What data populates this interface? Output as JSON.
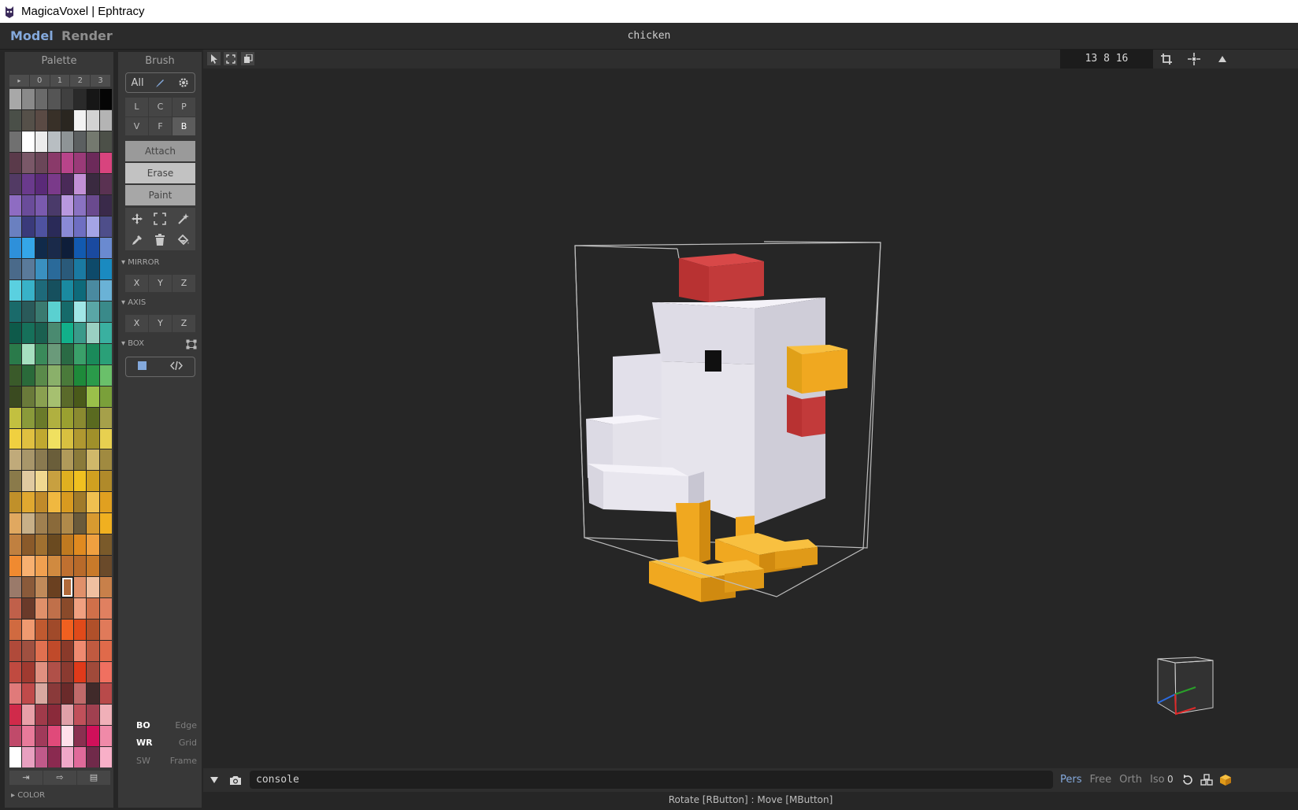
{
  "window": {
    "title": "MagicaVoxel | Ephtracy"
  },
  "topbar": {
    "tab_model": "Model",
    "tab_render": "Render",
    "filename": "chicken"
  },
  "palette": {
    "title": "Palette",
    "tabs": [
      "▸",
      "0",
      "1",
      "2",
      "3"
    ],
    "colors": [
      "#a8a8a8",
      "#8a8a8a",
      "#6a6a6a",
      "#555555",
      "#404040",
      "#2a2a2a",
      "#161616",
      "#050505",
      "#4a4f48",
      "#555049",
      "#5a4a44",
      "#383028",
      "#2a2620",
      "#f2f2f2",
      "#d2d2d2",
      "#b4b4b4",
      "#707070",
      "#ffffff",
      "#ececec",
      "#b8bec2",
      "#8e9496",
      "#5b5f60",
      "#74796f",
      "#4c5048",
      "#5a3a4a",
      "#7a5868",
      "#6a4658",
      "#8a3a6a",
      "#b8448a",
      "#9a3a78",
      "#6c2a5a",
      "#d8447e",
      "#523a64",
      "#6a3a8c",
      "#5a2a78",
      "#7a3a8a",
      "#4a2a58",
      "#c290d6",
      "#3a2a40",
      "#5a3252",
      "#8e6cc2",
      "#6a4c9a",
      "#7a5aae",
      "#4a3a6a",
      "#b898de",
      "#8a72c2",
      "#6a4a8e",
      "#3a2a4a",
      "#6a80c0",
      "#3a3a7a",
      "#4e52a0",
      "#2a2a58",
      "#8a8ad6",
      "#6e6ec2",
      "#a4a4e6",
      "#4e4e8a",
      "#2e90da",
      "#34a6e8",
      "#102a4a",
      "#1a2a4a",
      "#0e1e3a",
      "#125ab0",
      "#1a4aa0",
      "#6a8ad0",
      "#4a6a8a",
      "#5a7a9a",
      "#3a90c0",
      "#2a6a9a",
      "#2a5a7a",
      "#1a7aa2",
      "#0e4a6a",
      "#1a8ac0",
      "#5ad0e0",
      "#38b2c8",
      "#1e6a7a",
      "#16505e",
      "#1a8aa0",
      "#0e6a7a",
      "#4a8aa0",
      "#6ab2d6",
      "#1a6a6a",
      "#2a5a5a",
      "#3a7a70",
      "#5ad0d0",
      "#166a6a",
      "#a0e6e6",
      "#5aa6a6",
      "#3a8a8a",
      "#0e5a4a",
      "#16705a",
      "#1a6050",
      "#4a8a70",
      "#12b08a",
      "#3a9a8a",
      "#9ad0c2",
      "#3ab0a0",
      "#2a7a4a",
      "#a6e0c0",
      "#3a8a5a",
      "#6a9a7a",
      "#2a6a44",
      "#3aa06a",
      "#1a8a5a",
      "#2aa078",
      "#3a5a2a",
      "#2a6a3a",
      "#5a8a4a",
      "#8ab06a",
      "#4a7a3a",
      "#1e8a3a",
      "#2a9a4a",
      "#6ac06a",
      "#3a4a20",
      "#6a7a3a",
      "#8aa050",
      "#a6c070",
      "#5a6a2a",
      "#4a5a1a",
      "#9ac04a",
      "#7aa03a",
      "#c2c040",
      "#8a9a3a",
      "#6a7a2a",
      "#b0b040",
      "#9aa030",
      "#8a8a30",
      "#5a6a20",
      "#a6a04a",
      "#f0d040",
      "#e0c040",
      "#c0a830",
      "#f0e060",
      "#d8c040",
      "#b09830",
      "#a0902a",
      "#e8d050",
      "#c0aa7a",
      "#a8966a",
      "#8a7a50",
      "#6a5e3a",
      "#b09a5a",
      "#8a7a3a",
      "#d0b86a",
      "#a08a40",
      "#8a7a4a",
      "#e0caa0",
      "#f0d890",
      "#c8a040",
      "#e0b020",
      "#f0c020",
      "#d0a020",
      "#b08a2a",
      "#c0902a",
      "#e0a830",
      "#c08a2a",
      "#f0b840",
      "#d89a20",
      "#a07a2a",
      "#f0c050",
      "#e0a020",
      "#e0a860",
      "#c8b088",
      "#a08050",
      "#8a6a3a",
      "#b08a4a",
      "#6a5a3a",
      "#d89a30",
      "#f0b020",
      "#c08040",
      "#8a5a2a",
      "#a07030",
      "#6a4a20",
      "#c07a20",
      "#e08a20",
      "#f0a040",
      "#7a5a2a",
      "#f08a30",
      "#f8b070",
      "#f0a050",
      "#d08a40",
      "#c07030",
      "#b86a2a",
      "#c87a2a",
      "#6a4a2a",
      "#9a7a6a",
      "#8a5a3a",
      "#c08a5a",
      "#6a4020",
      "#b06a3a",
      "#e0906a",
      "#f0c0a0",
      "#c8804a",
      "#c0604a",
      "#6a3a2a",
      "#e0906a",
      "#c0704a",
      "#8a4a2a",
      "#f0a080",
      "#d0704a",
      "#e08060",
      "#d06a40",
      "#f09a70",
      "#c05a30",
      "#a04a2a",
      "#f06020",
      "#e04a1a",
      "#b0502a",
      "#e07a5a",
      "#b04a3a",
      "#a05040",
      "#e07050",
      "#c04a2a",
      "#8a3a2a",
      "#f08a70",
      "#c05a40",
      "#e06a4a",
      "#c04a40",
      "#a03a30",
      "#e09080",
      "#b05048",
      "#8a3a30",
      "#e03a1a",
      "#a04a3a",
      "#f07060",
      "#e07a7a",
      "#c04a4a",
      "#d8a8a0",
      "#8a3a3a",
      "#6a2a2a",
      "#c06a6a",
      "#402a2a",
      "#b84a4a",
      "#d02a4a",
      "#e8a0a8",
      "#a03a4a",
      "#8a2a3a",
      "#e0a0a8",
      "#c0505a",
      "#a04050",
      "#f0b0b8",
      "#c04a6a",
      "#e87a9a",
      "#a03a5a",
      "#e04a7a",
      "#ffe0ea",
      "#8a3050",
      "#d0105a",
      "#f08aa8",
      "#ffffff",
      "#e8a0c0",
      "#c05a8a",
      "#8a2a50",
      "#f0a8c8",
      "#e06a9a",
      "#702a4a",
      "#f8b0c8"
    ],
    "selected_index": 188,
    "actions": [
      "⇥",
      "⇨",
      "▤"
    ],
    "color_label": "COLOR"
  },
  "brush": {
    "title": "Brush",
    "mode": "All",
    "shapes": [
      "L",
      "C",
      "P",
      "V",
      "F",
      "B"
    ],
    "active_shape": "B",
    "attach": "Attach",
    "erase": "Erase",
    "paint": "Paint",
    "mirror_label": "MIRROR",
    "axis_label": "AXIS",
    "box_label": "BOX",
    "mirror": [
      "X",
      "Y",
      "Z"
    ],
    "axis": [
      "X",
      "Y",
      "Z"
    ],
    "render_opts": [
      {
        "left": "BO",
        "right": "Edge"
      },
      {
        "left": "WR",
        "right": "Grid"
      },
      {
        "left": "SW",
        "right": "Frame"
      }
    ]
  },
  "viewport": {
    "coords": "13 8 16",
    "voxel_colors": {
      "white": "#e6e4ec",
      "red": "#c23a3a",
      "orange": "#f0a820",
      "eye": "#101010"
    }
  },
  "console": {
    "input": "console",
    "view_modes": [
      "Pers",
      "Free",
      "Orth",
      "Iso"
    ],
    "active_view": "Pers",
    "number": "0",
    "status": "Rotate [RButton] : Move [MButton]"
  }
}
